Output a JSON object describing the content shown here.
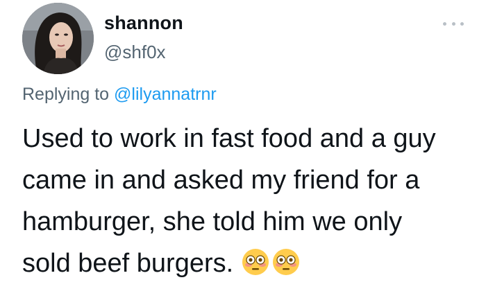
{
  "tweet": {
    "author": {
      "display_name": "shannon",
      "handle": "@shf0x",
      "avatar_icon": "profile-photo"
    },
    "more_icon": "ellipsis-icon",
    "reply": {
      "prefix": "Replying to",
      "mention": "@lilyannatrnr"
    },
    "text_lines": [
      "Used to work in fast food and a guy",
      "came in and asked my friend for a",
      "hamburger, she told him we only",
      "sold beef burgers."
    ],
    "emojis": [
      "flushed-face-emoji",
      "flushed-face-emoji"
    ],
    "colors": {
      "text": "#0f1419",
      "secondary": "#536471",
      "link": "#1d9bf0"
    }
  }
}
